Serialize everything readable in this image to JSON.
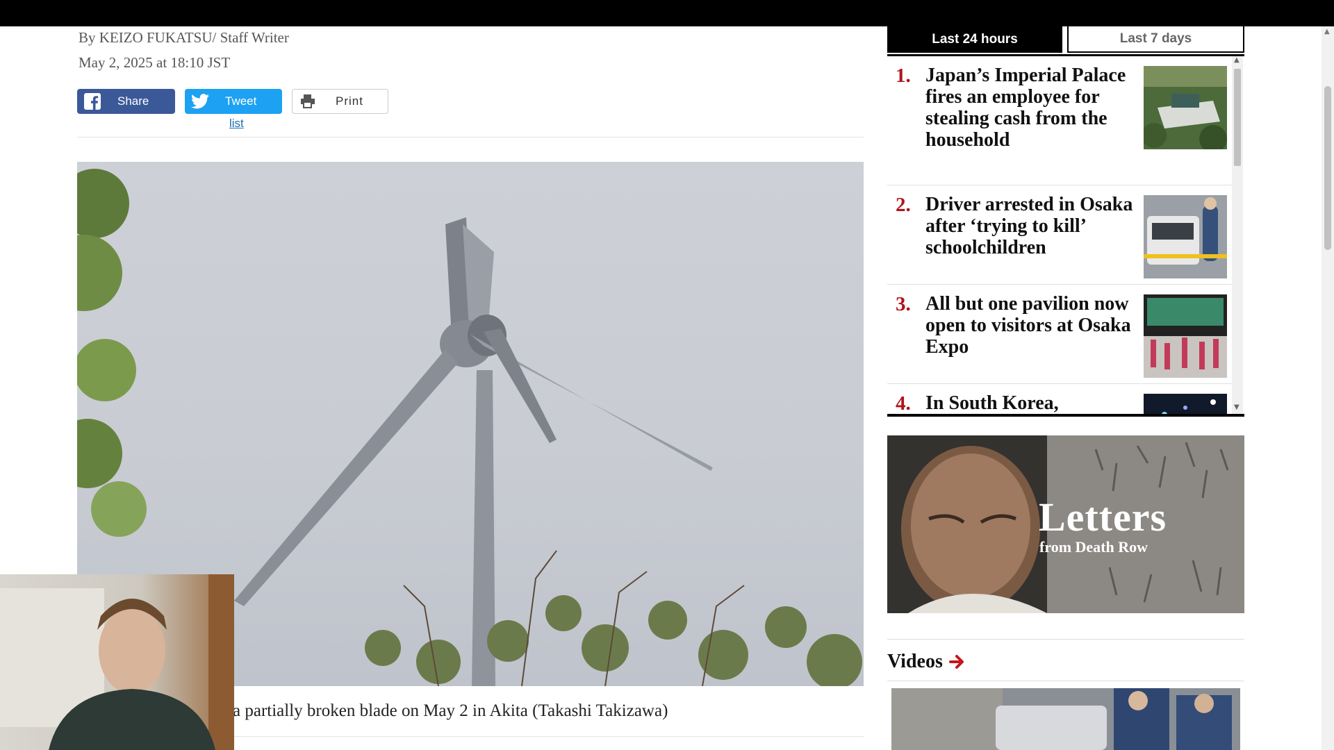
{
  "article": {
    "byline": "By KEIZO FUKATSU/ Staff Writer",
    "date": "May 2, 2025 at 18:10 JST",
    "share": {
      "share_label": "Share",
      "tweet_label": "Tweet",
      "print_label": "Print",
      "list_label": "list"
    },
    "caption": "a partially broken blade on May 2 in Akita (Takashi Takizawa)"
  },
  "ranking": {
    "tabs": [
      {
        "label": "Last 24 hours",
        "active": true
      },
      {
        "label": "Last 7 days",
        "active": false
      }
    ],
    "items": [
      {
        "rank": "1.",
        "title": "Japan’s Imperial Palace fires an employee for stealing cash from the household"
      },
      {
        "rank": "2.",
        "title": "Driver arrested in Osaka after ‘trying to kill’ schoolchildren"
      },
      {
        "rank": "3.",
        "title": "All but one pavilion now open to visitors at Osaka Expo"
      },
      {
        "rank": "4.",
        "title": "In South Korea,"
      }
    ]
  },
  "banner": {
    "title": "Letters",
    "subtitle": "from Death Row"
  },
  "videos": {
    "heading": "Videos"
  },
  "colors": {
    "rank_number": "#b0141b",
    "facebook": "#3b5998",
    "twitter": "#1da1f2",
    "link": "#1a6fb5"
  },
  "icons": {
    "share": "facebook-icon",
    "tweet": "twitter-icon",
    "print": "printer-icon",
    "videos": "arrow-right-icon"
  }
}
